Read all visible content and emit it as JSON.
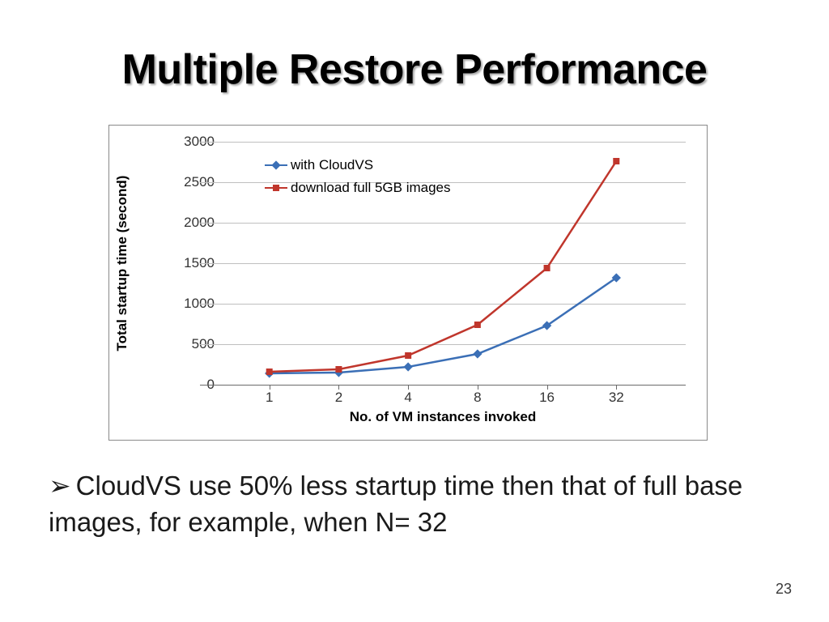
{
  "slide": {
    "title": "Multiple Restore Performance",
    "bullet_arrow": "➢",
    "bullet_text": "CloudVS use 50% less startup time then that of full base images, for example, when N= 32",
    "page_number": "23"
  },
  "chart_data": {
    "type": "line",
    "xlabel": "No. of VM instances invoked",
    "ylabel": "Total startup time (second)",
    "categories": [
      "1",
      "2",
      "4",
      "8",
      "16",
      "32"
    ],
    "series": [
      {
        "name": "with CloudVS",
        "color": "#3b6fb6",
        "marker": "diamond",
        "values": [
          140,
          150,
          220,
          380,
          730,
          1320
        ]
      },
      {
        "name": "download full 5GB images",
        "color": "#c0362c",
        "marker": "square",
        "values": [
          160,
          190,
          360,
          740,
          1440,
          2760
        ]
      }
    ],
    "ylim": [
      0,
      3000
    ],
    "yticks": [
      0,
      500,
      1000,
      1500,
      2000,
      2500,
      3000
    ]
  }
}
